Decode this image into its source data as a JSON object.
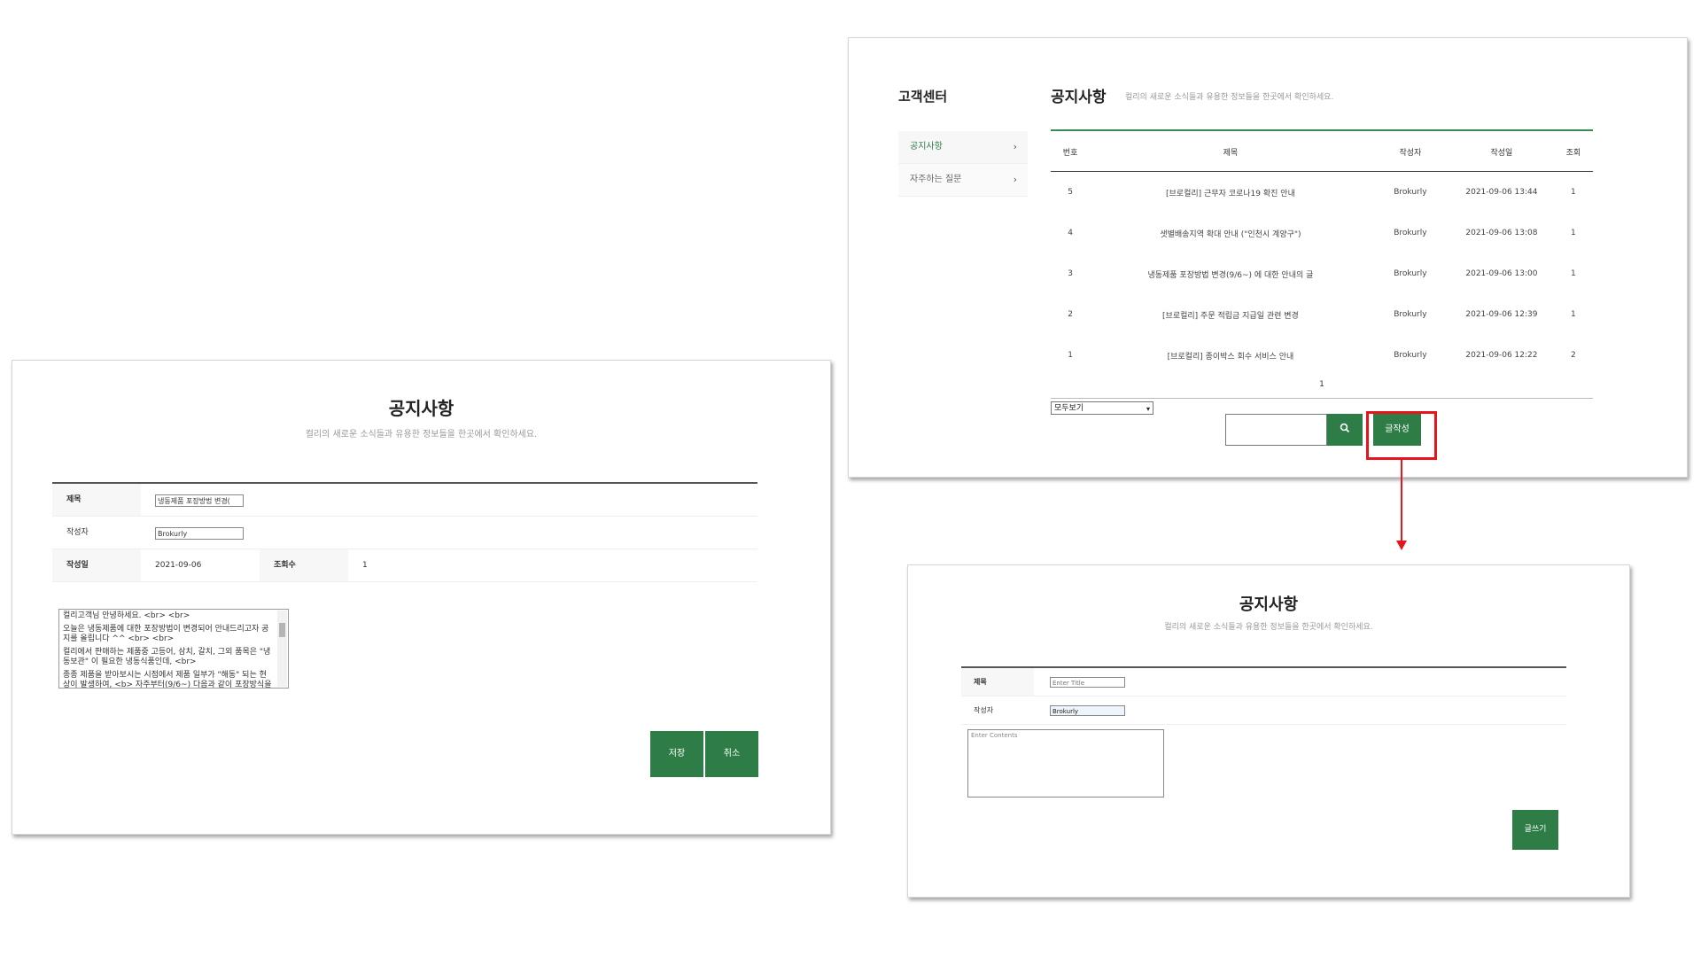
{
  "list_panel": {
    "sidebar": {
      "title": "고객센터",
      "items": [
        {
          "label": "공지사항",
          "chevron": "chevron-right-icon"
        },
        {
          "label": "자주하는 질문",
          "chevron": "chevron-right-icon"
        }
      ]
    },
    "page_title": "공지사항",
    "page_subtitle": "컬리의 새로운 소식들과 유용한 정보들을 한곳에서 확인하세요.",
    "table": {
      "headers": [
        "번호",
        "제목",
        "작성자",
        "작성일",
        "조회"
      ],
      "rows": [
        [
          "5",
          "[브로컬리] 근무자 코로나19 확진 안내",
          "Brokurly",
          "2021-09-06 13:44",
          "1"
        ],
        [
          "4",
          "샛별배송지역 확대 안내 (\"인천시 계양구\")",
          "Brokurly",
          "2021-09-06 13:08",
          "1"
        ],
        [
          "3",
          "냉동제품 포장방법 변경(9/6~) 에 대한 안내의 글",
          "Brokurly",
          "2021-09-06 13:00",
          "1"
        ],
        [
          "2",
          "[브로컬리] 주문 적립금 지급일 관련 변경",
          "Brokurly",
          "2021-09-06 12:39",
          "1"
        ],
        [
          "1",
          "[브로컬리] 종이박스 회수 서비스 안내",
          "Brokurly",
          "2021-09-06 12:22",
          "2"
        ]
      ]
    },
    "pager": "1",
    "filter_select": "모두보기",
    "search_icon": "search-icon",
    "write_button": "글작성"
  },
  "edit_panel": {
    "title": "공지사항",
    "subtitle": "컬리의 새로운 소식들과 유용한 정보들을 한곳에서 확인하세요.",
    "fields": {
      "title_label": "제목",
      "title_value": "냉동제품 포장방법 변경(",
      "author_label": "작성자",
      "author_value": "Brokurly",
      "date_label": "작성일",
      "date_value": "2021-09-06",
      "views_label": "조회수",
      "views_value": "1"
    },
    "content_lines": [
      "컬리고객님 안녕하세요. <br> <br>",
      "오늘은 냉동제품에 대한 포장방법이 변경되어 안내드리고자 공지를 올립니다 ^^ <br> <br>",
      "컬리에서 판매하는 제품중 고등어, 삼치, 갈치, 그외 품목은 \"냉동보관\" 이 필요한 냉동식품인데, <br>",
      "종종 제품을 받아보시는 시점에서 제품 일부가 \"해동\" 되는 현상이 발생하여, <b> 자주부터(9/6~) 다음과 같이 포장방식을"
    ],
    "save_button": "저장",
    "cancel_button": "취소"
  },
  "write_panel": {
    "title": "공지사항",
    "subtitle": "컬리의 새로운 소식들과 유용한 정보들을 한곳에서 확인하세요.",
    "fields": {
      "title_label": "제목",
      "title_placeholder": "Enter Title",
      "author_label": "작성자",
      "author_value": "Brokurly",
      "content_placeholder": "Enter Contents"
    },
    "submit_button": "글쓰기"
  },
  "colors": {
    "accent_green": "#2f7d46",
    "highlight_red": "#e8141c"
  }
}
